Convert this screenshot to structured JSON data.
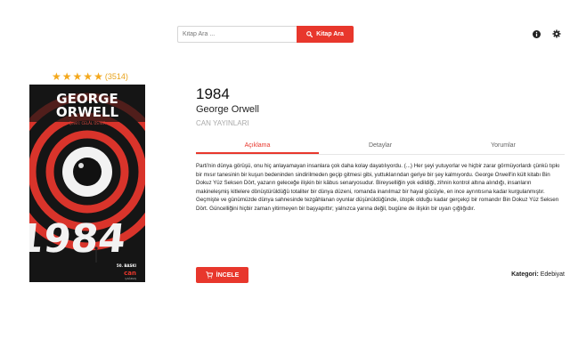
{
  "search": {
    "placeholder": "Kitap Ara ...",
    "button_label": "Kitap Ara"
  },
  "header_icons": [
    "info-icon",
    "gear-icon"
  ],
  "rating": {
    "stars": 5,
    "count": "(3514)"
  },
  "cover": {
    "author_line1": "GEORGE",
    "author_line2": "ORWELL",
    "translator": "Çeviri: CELÂL ÜSTER",
    "big_title": "1984",
    "edition": "50. BASKI",
    "publisher_logo": "can",
    "series": "ÇAĞDAŞ"
  },
  "book": {
    "title": "1984",
    "author": "George Orwell",
    "publisher": "CAN YAYINLARI"
  },
  "tabs": [
    {
      "label": "Açıklama",
      "active": true
    },
    {
      "label": "Detaylar",
      "active": false
    },
    {
      "label": "Yorumlar",
      "active": false
    }
  ],
  "description": "Parti'nin dünya görüşü, onu hiç anlayamayan insanlara çok daha kolay dayatılıyordu. (...) Her şeyi yutuyorlar ve hiçbir zarar görmüyorlardı çünkü tıpkı bir mısır tanesinin bir kuşun bedeninden sindirilmeden geçip gitmesi gibi, yuttuklarından geriye bir şey kalmıyordu. George Orwell'in kült kitabı Bin Dokuz Yüz Seksen Dört, yazarın geleceğe ilişkin bir kâbus senaryosudur. Bireyselliğin yok edildiği, zihnin kontrol altına alındığı, insanların makineleşmiş kitlelere dönüştürüldüğü totaliter bir dünya düzeni, romanda inanılmaz bir hayal gücüyle, en ince ayrıntısına kadar kurgulanmıştır. Geçmişte ve günümüzde dünya sahnesinde tezgâhlanan oyunlar düşünüldüğünde, ütopik olduğu kadar gerçekçi bir romandır Bin Dokuz Yüz Seksen Dört. Güncelliğini hiçbir zaman yitirmeyen bir başyapıttır; yalnızca yarına değil, bugüne de ilişkin bir uyarı çığlığıdır.",
  "actions": {
    "inspect_label": "İNCELE"
  },
  "category": {
    "label": "Kategori:",
    "value": "Edebiyat"
  },
  "colors": {
    "accent": "#e8372c",
    "star": "#f4a81c",
    "cover_bg": "#151515"
  }
}
